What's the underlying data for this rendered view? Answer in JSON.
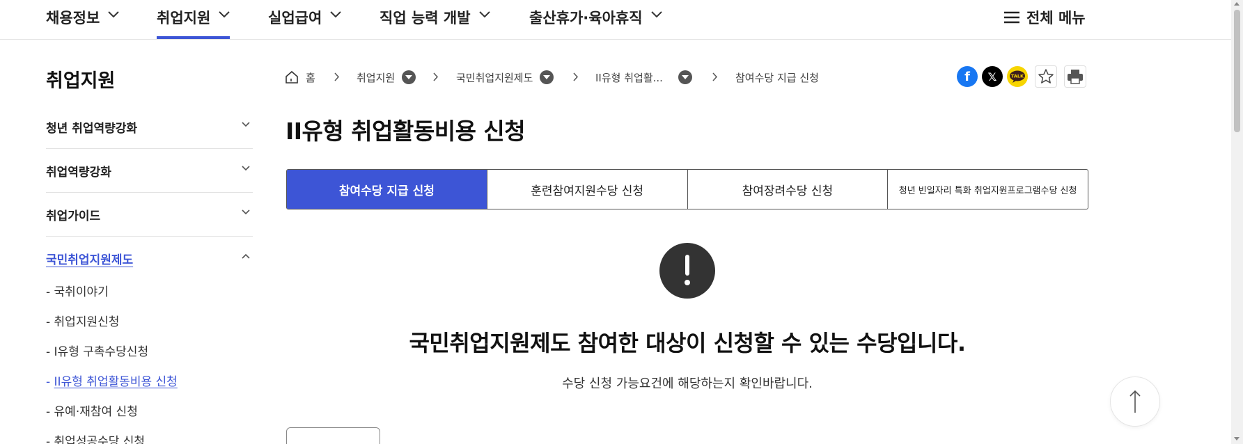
{
  "topnav": {
    "items": [
      {
        "label": "채용정보"
      },
      {
        "label": "취업지원",
        "active": true
      },
      {
        "label": "실업급여"
      },
      {
        "label": "직업 능력 개발"
      },
      {
        "label": "출산휴가·육아휴직"
      }
    ],
    "all_menu_label": "전체 메뉴"
  },
  "sidebar": {
    "title": "취업지원",
    "groups": [
      {
        "label": "청년 취업역량강화"
      },
      {
        "label": "취업역량강화"
      },
      {
        "label": "취업가이드"
      },
      {
        "label": "국민취업지원제도",
        "open": true
      }
    ],
    "sub_items": [
      {
        "label": "국취이야기"
      },
      {
        "label": "취업지원신청"
      },
      {
        "label": "I유형 구촉수당신청"
      },
      {
        "label": "II유형 취업활동비용 신청",
        "current": true
      },
      {
        "label": "유예·재참여 신청"
      },
      {
        "label": "취업성공수당 신청"
      }
    ]
  },
  "breadcrumb": {
    "home": "홈",
    "items": [
      "취업지원",
      "국민취업지원제도",
      "II유형 취업활...",
      "참여수당 지급 신청"
    ]
  },
  "share": {
    "facebook_icon": "facebook-icon",
    "x_icon": "x-icon",
    "kakao_label": "TALK"
  },
  "page": {
    "title": "II유형 취업활동비용 신청"
  },
  "tabs": [
    {
      "label": "참여수당 지급 신청",
      "active": true
    },
    {
      "label": "훈련참여지원수당 신청"
    },
    {
      "label": "참여장려수당 신청"
    },
    {
      "label": "청년 빈일자리 특화 취업지원프로그램수당 신청"
    }
  ],
  "alert": {
    "message": "국민취업지원제도 참여한 대상이 신청할 수 있는 수당입니다.",
    "sub": "수당 신청 가능요건에 해당하는지 확인바랍니다."
  },
  "colors": {
    "accent": "#3d55d6",
    "facebook": "#1877f2",
    "kakao": "#f7d500"
  }
}
